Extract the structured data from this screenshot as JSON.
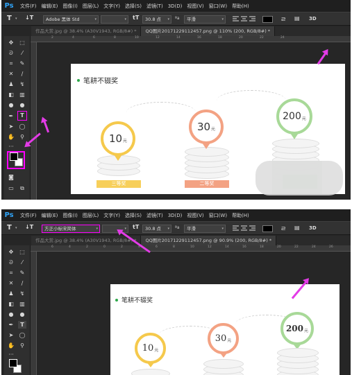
{
  "app": {
    "logo": "Ps"
  },
  "menu": [
    "文件(F)",
    "编辑(E)",
    "图像(I)",
    "图层(L)",
    "文字(Y)",
    "选择(S)",
    "滤镜(T)",
    "3D(D)",
    "视图(V)",
    "窗口(W)",
    "帮助(H)"
  ],
  "shot_a": {
    "options": {
      "font_family": "Adobe 黑体 Std",
      "font_size": "30.8 点",
      "aa_label": "ªa",
      "aa_mode": "平滑",
      "size_icon": "tT",
      "threeD": "3D"
    },
    "tabs": [
      "作品大赏.jpg @ 38.4% (A30V1943, RGB/8#) *",
      "QQ图片20171229112457.png @ 110% (200, RGB/8#) *"
    ],
    "ruler_ticks": [
      "2",
      "4",
      "6",
      "8",
      "10",
      "12",
      "14",
      "16",
      "18",
      "20",
      "22",
      "24"
    ]
  },
  "shot_b": {
    "options": {
      "font_family": "方正小标宋简体",
      "font_size": "30.8 点",
      "aa_label": "ªa",
      "aa_mode": "平滑",
      "size_icon": "tT",
      "threeD": "3D"
    },
    "tabs": [
      "作品大赏.jpg @ 38.4% (A30V1943, RGB/8#) *",
      "QQ图片20171229112457.png @ 90.9% (200, RGB/8#) *"
    ],
    "ruler_ticks": [
      "6",
      "4",
      "2",
      "0",
      "2",
      "4",
      "6",
      "8",
      "10",
      "12",
      "14",
      "16",
      "18",
      "20",
      "22",
      "24",
      "26"
    ]
  },
  "canvas": {
    "title": "笔耕不辍奖",
    "prizes": [
      {
        "value": "10",
        "unit": "元",
        "color": "#f5c94c",
        "ribbon": "三等奖",
        "ribbon_color": "#f7cf5a"
      },
      {
        "value": "30",
        "unit": "元",
        "color": "#f3a283",
        "ribbon": "二等奖",
        "ribbon_color": "#f3a283"
      },
      {
        "value": "200",
        "unit": "元",
        "color": "#a8d998",
        "ribbon": "",
        "ribbon_color": "#a8d998"
      }
    ]
  },
  "colors": {
    "highlight": "#ff00ff",
    "arrow": "#e33be7",
    "ps_blue": "#2fa3f7"
  }
}
